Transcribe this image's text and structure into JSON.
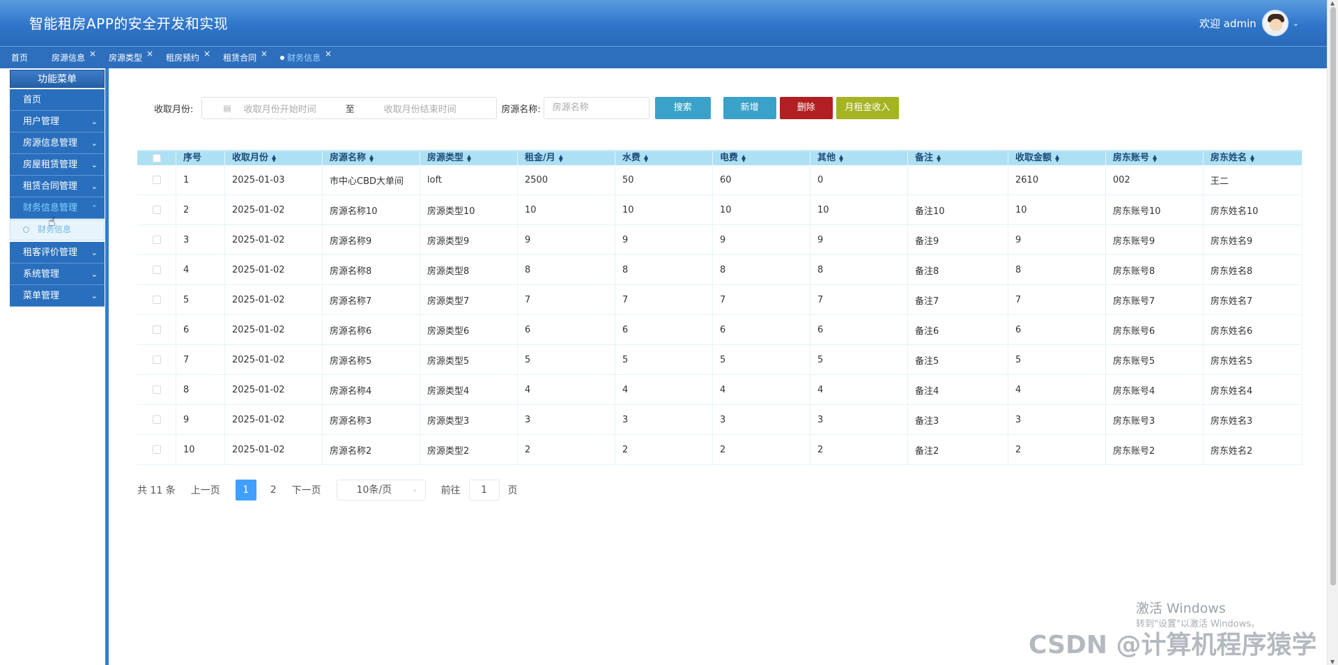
{
  "header": {
    "title": "智能租房APP的安全开发和实现",
    "welcome": "欢迎 admin"
  },
  "tabs": [
    {
      "label": "首页",
      "closable": false
    },
    {
      "label": "房源信息",
      "closable": true
    },
    {
      "label": "房源类型",
      "closable": true
    },
    {
      "label": "租房预约",
      "closable": true
    },
    {
      "label": "租赁合同",
      "closable": true
    },
    {
      "label": "财务信息",
      "closable": true,
      "active": true
    }
  ],
  "sidebar": {
    "title": "功能菜单",
    "items": [
      {
        "label": "首页"
      },
      {
        "label": "用户管理"
      },
      {
        "label": "房源信息管理"
      },
      {
        "label": "房屋租赁管理"
      },
      {
        "label": "租赁合同管理"
      },
      {
        "label": "财务信息管理"
      },
      {
        "label": "财务信息"
      },
      {
        "label": "租客评价管理"
      },
      {
        "label": "系统管理"
      },
      {
        "label": "菜单管理"
      }
    ]
  },
  "search": {
    "month_label": "收取月份:",
    "start_placeholder": "收取月份开始时间",
    "range_sep": "至",
    "end_placeholder": "收取月份结束时间",
    "name_label": "房源名称:",
    "name_placeholder": "房源名称",
    "search_btn": "搜索",
    "add_btn": "新增",
    "delete_btn": "删除",
    "income_btn": "月租金收入"
  },
  "table": {
    "headers": [
      "序号",
      "收取月份",
      "房源名称",
      "房源类型",
      "租金/月",
      "水费",
      "电费",
      "其他",
      "备注",
      "收取金额",
      "房东账号",
      "房东姓名"
    ],
    "rows": [
      [
        "1",
        "2025-01-03",
        "市中心CBD大单间",
        "loft",
        "2500",
        "50",
        "60",
        "0",
        "",
        "2610",
        "002",
        "王二"
      ],
      [
        "2",
        "2025-01-02",
        "房源名称10",
        "房源类型10",
        "10",
        "10",
        "10",
        "10",
        "备注10",
        "10",
        "房东账号10",
        "房东姓名10"
      ],
      [
        "3",
        "2025-01-02",
        "房源名称9",
        "房源类型9",
        "9",
        "9",
        "9",
        "9",
        "备注9",
        "9",
        "房东账号9",
        "房东姓名9"
      ],
      [
        "4",
        "2025-01-02",
        "房源名称8",
        "房源类型8",
        "8",
        "8",
        "8",
        "8",
        "备注8",
        "8",
        "房东账号8",
        "房东姓名8"
      ],
      [
        "5",
        "2025-01-02",
        "房源名称7",
        "房源类型7",
        "7",
        "7",
        "7",
        "7",
        "备注7",
        "7",
        "房东账号7",
        "房东姓名7"
      ],
      [
        "6",
        "2025-01-02",
        "房源名称6",
        "房源类型6",
        "6",
        "6",
        "6",
        "6",
        "备注6",
        "6",
        "房东账号6",
        "房东姓名6"
      ],
      [
        "7",
        "2025-01-02",
        "房源名称5",
        "房源类型5",
        "5",
        "5",
        "5",
        "5",
        "备注5",
        "5",
        "房东账号5",
        "房东姓名5"
      ],
      [
        "8",
        "2025-01-02",
        "房源名称4",
        "房源类型4",
        "4",
        "4",
        "4",
        "4",
        "备注4",
        "4",
        "房东账号4",
        "房东姓名4"
      ],
      [
        "9",
        "2025-01-02",
        "房源名称3",
        "房源类型3",
        "3",
        "3",
        "3",
        "3",
        "备注3",
        "3",
        "房东账号3",
        "房东姓名3"
      ],
      [
        "10",
        "2025-01-02",
        "房源名称2",
        "房源类型2",
        "2",
        "2",
        "2",
        "2",
        "备注2",
        "2",
        "房东账号2",
        "房东姓名2"
      ]
    ]
  },
  "pagination": {
    "total": "共 11 条",
    "prev": "上一页",
    "current": "1",
    "page2": "2",
    "next": "下一页",
    "page_size": "10条/页",
    "goto_label": "前往",
    "goto_value": "1",
    "page_unit": "页"
  },
  "watermark": {
    "activate_title": "激活 Windows",
    "activate_sub": "转到\"设置\"以激活 Windows。",
    "csdn": "CSDN @计算机程序猿学长"
  }
}
